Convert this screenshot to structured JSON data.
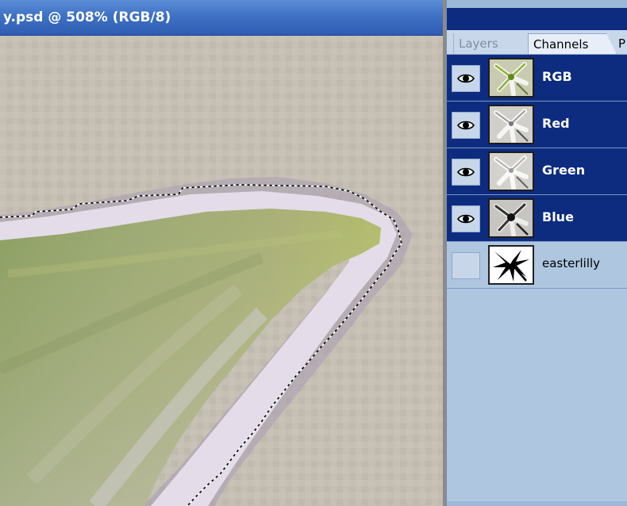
{
  "document": {
    "title": "y.psd @ 508% (RGB/8)",
    "zoom": "508%",
    "mode": "RGB/8"
  },
  "palette": {
    "tabs": [
      {
        "label": "Layers",
        "active": false
      },
      {
        "label": "Channels",
        "active": true
      },
      {
        "label": "P",
        "active": false
      }
    ],
    "channels": [
      {
        "name": "RGB",
        "visible": true,
        "selected": true,
        "thumb": "rgb-composite"
      },
      {
        "name": "Red",
        "visible": true,
        "selected": true,
        "thumb": "red-channel"
      },
      {
        "name": "Green",
        "visible": true,
        "selected": true,
        "thumb": "green-channel"
      },
      {
        "name": "Blue",
        "visible": true,
        "selected": true,
        "thumb": "blue-channel"
      },
      {
        "name": "easterlilly",
        "visible": false,
        "selected": false,
        "thumb": "alpha-mask"
      }
    ]
  },
  "colors": {
    "title_bar": "#3f71c4",
    "palette_header": "#0d2c80",
    "selected_row": "#0d2c80",
    "palette_bg": "#aec6e0",
    "canvas_bg": "#c5beb3",
    "petal_green": "#9db160",
    "petal_highlight": "#e4dde9"
  }
}
